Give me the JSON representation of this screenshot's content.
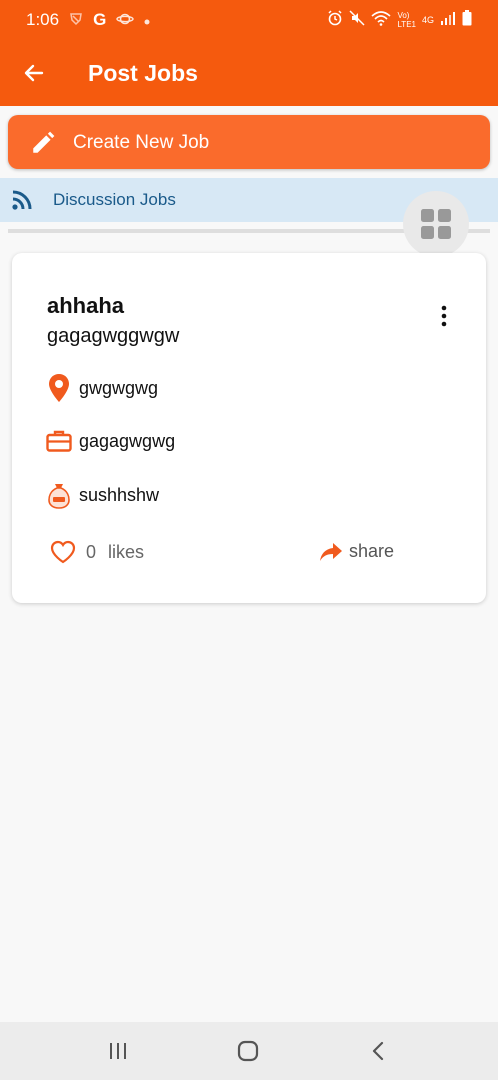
{
  "status_bar": {
    "time": "1:06",
    "left_icons": [
      "shield-icon",
      "google-icon",
      "planet-icon",
      "dot-icon"
    ],
    "right_icons": [
      "alarm-icon",
      "mute-icon",
      "wifi-icon",
      "volte-icon",
      "4g-icon",
      "signal-icon",
      "battery-icon"
    ],
    "volte_label": "Vo)",
    "lte_label": "LTE1",
    "net_label": "4G"
  },
  "app_bar": {
    "title": "Post Jobs",
    "back_icon": "arrow-left-icon",
    "background": "#f55a0e"
  },
  "create_button": {
    "label": "Create New Job",
    "icon": "pencil-icon",
    "background": "#fa6b2c"
  },
  "discussion_bar": {
    "label": "Discussion Jobs",
    "icon": "rss-icon",
    "background": "#d7e8f5"
  },
  "fab": {
    "icon": "grid-icon"
  },
  "job_card": {
    "title": "ahhaha",
    "subtitle": "gagagwggwgw",
    "location": "gwgwgwg",
    "job_type": "gagagwgwg",
    "salary": "sushhshw",
    "likes_count": "0",
    "likes_label": "likes",
    "share_label": "share",
    "accent": "#f05a1e"
  },
  "nav_bar": {
    "buttons": [
      "recent-apps-icon",
      "home-icon",
      "back-icon"
    ]
  }
}
